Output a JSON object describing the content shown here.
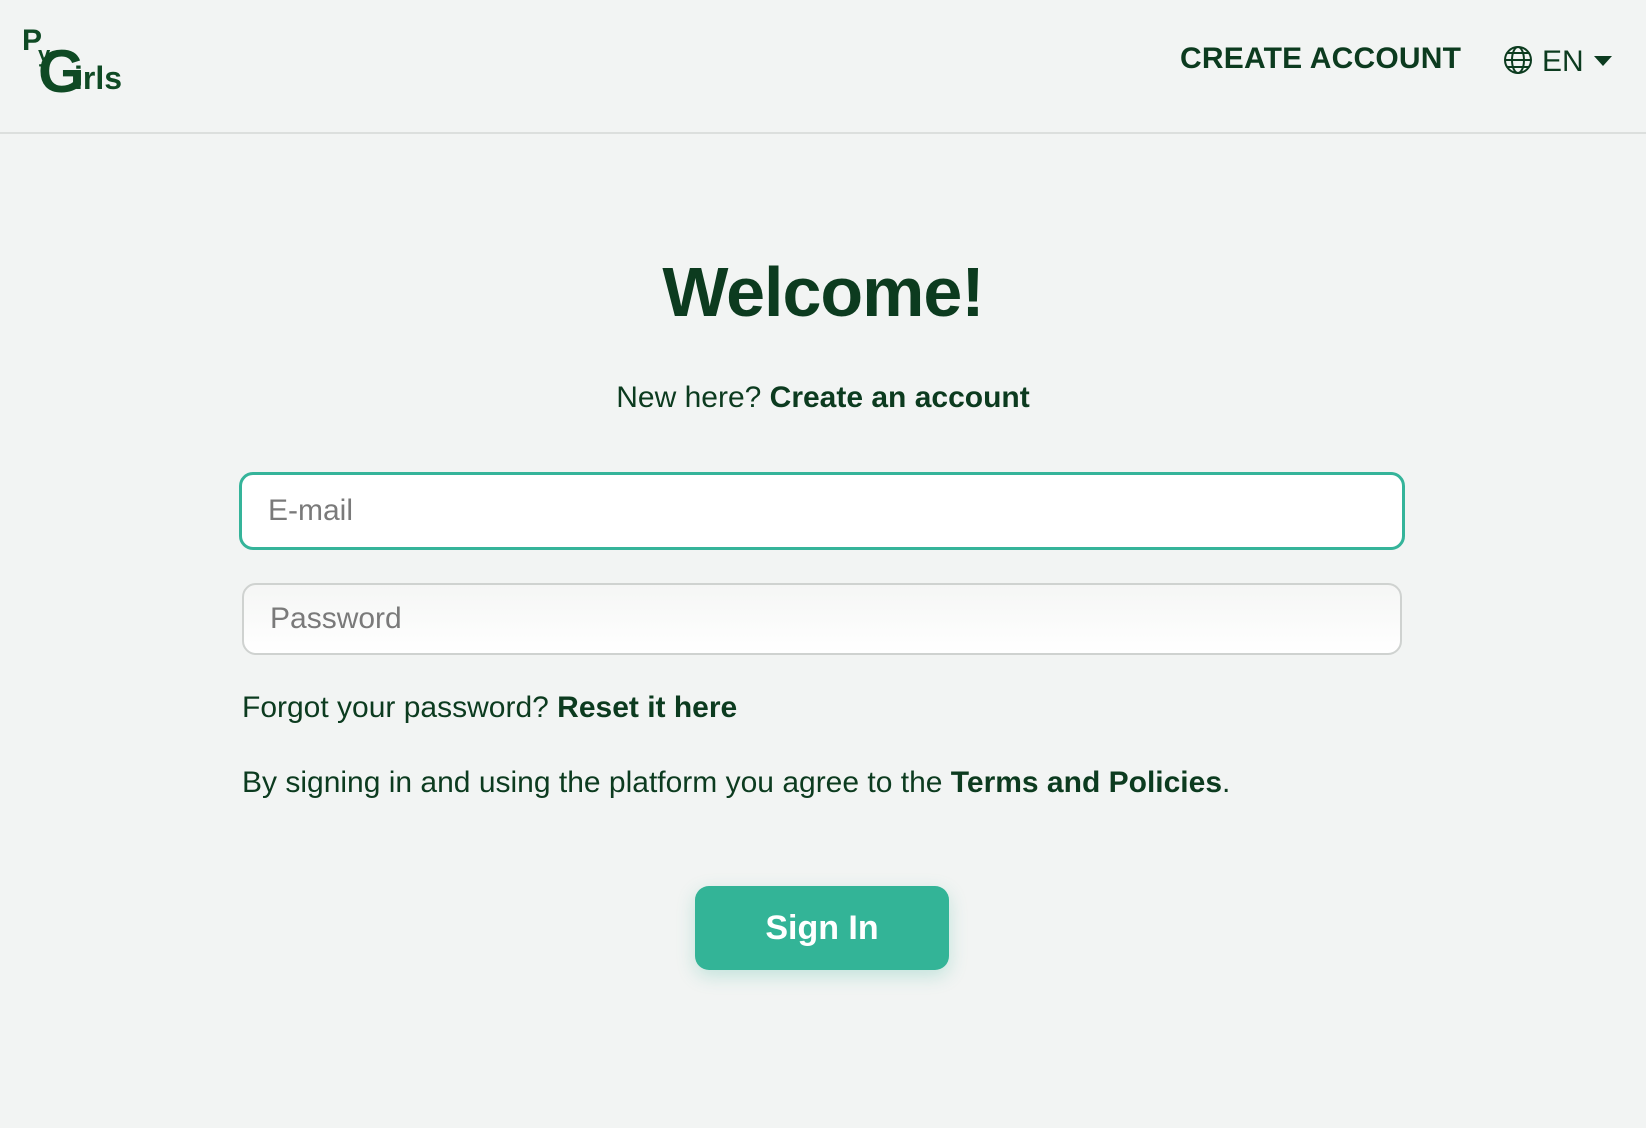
{
  "header": {
    "logo": {
      "p": "P",
      "y": "y",
      "g": "G",
      "rest": "irls"
    },
    "create_account_label": "CREATE ACCOUNT",
    "language": {
      "icon": "globe-icon",
      "selected": "EN",
      "dropdown_icon": "caret-down-icon"
    }
  },
  "main": {
    "title": "Welcome!",
    "new_here_text": "New here? ",
    "create_account_link": "Create an account",
    "email": {
      "placeholder": "E-mail",
      "value": ""
    },
    "password": {
      "placeholder": "Password",
      "value": ""
    },
    "forgot_text": "Forgot your password? ",
    "reset_link": "Reset it here",
    "terms_text": "By signing in and using the platform you agree to the ",
    "terms_link": "Terms and Policies",
    "terms_suffix": ".",
    "sign_in_label": "Sign In"
  },
  "colors": {
    "text": "#0c3b1f",
    "accent": "#33b497",
    "background": "#f2f4f3"
  }
}
